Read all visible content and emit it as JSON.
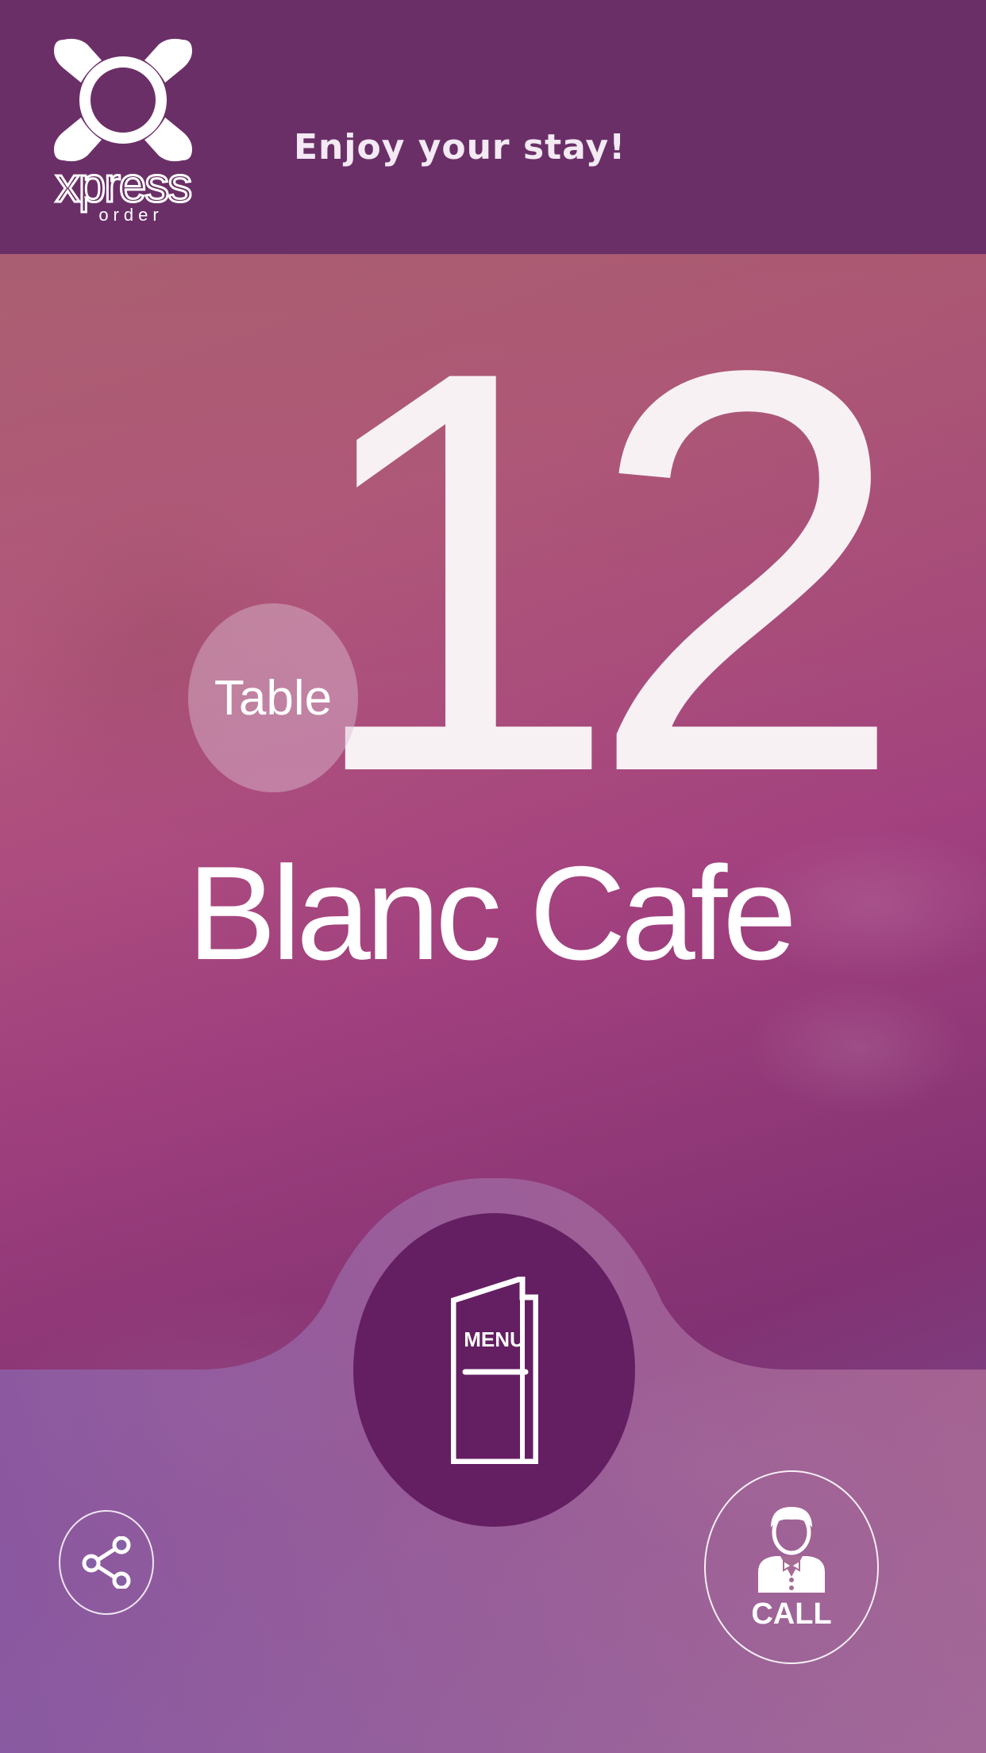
{
  "header": {
    "title": "Enjoy your stay!",
    "logo": {
      "icon": "xpress-order-logo-icon",
      "brand": "xpress",
      "sub": "order"
    }
  },
  "table": {
    "label": "Table",
    "number": "12"
  },
  "venue": {
    "name": "Blanc Cafe"
  },
  "actions": {
    "menu": {
      "label": "MENU",
      "icon": "menu-booklet-icon"
    },
    "share": {
      "icon": "share-icon"
    },
    "call": {
      "label": "CALL",
      "icon": "waiter-icon"
    }
  },
  "colors": {
    "header_bg": "#6b2f68",
    "menu_button_bg": "#641f62",
    "text": "#ffffff"
  }
}
